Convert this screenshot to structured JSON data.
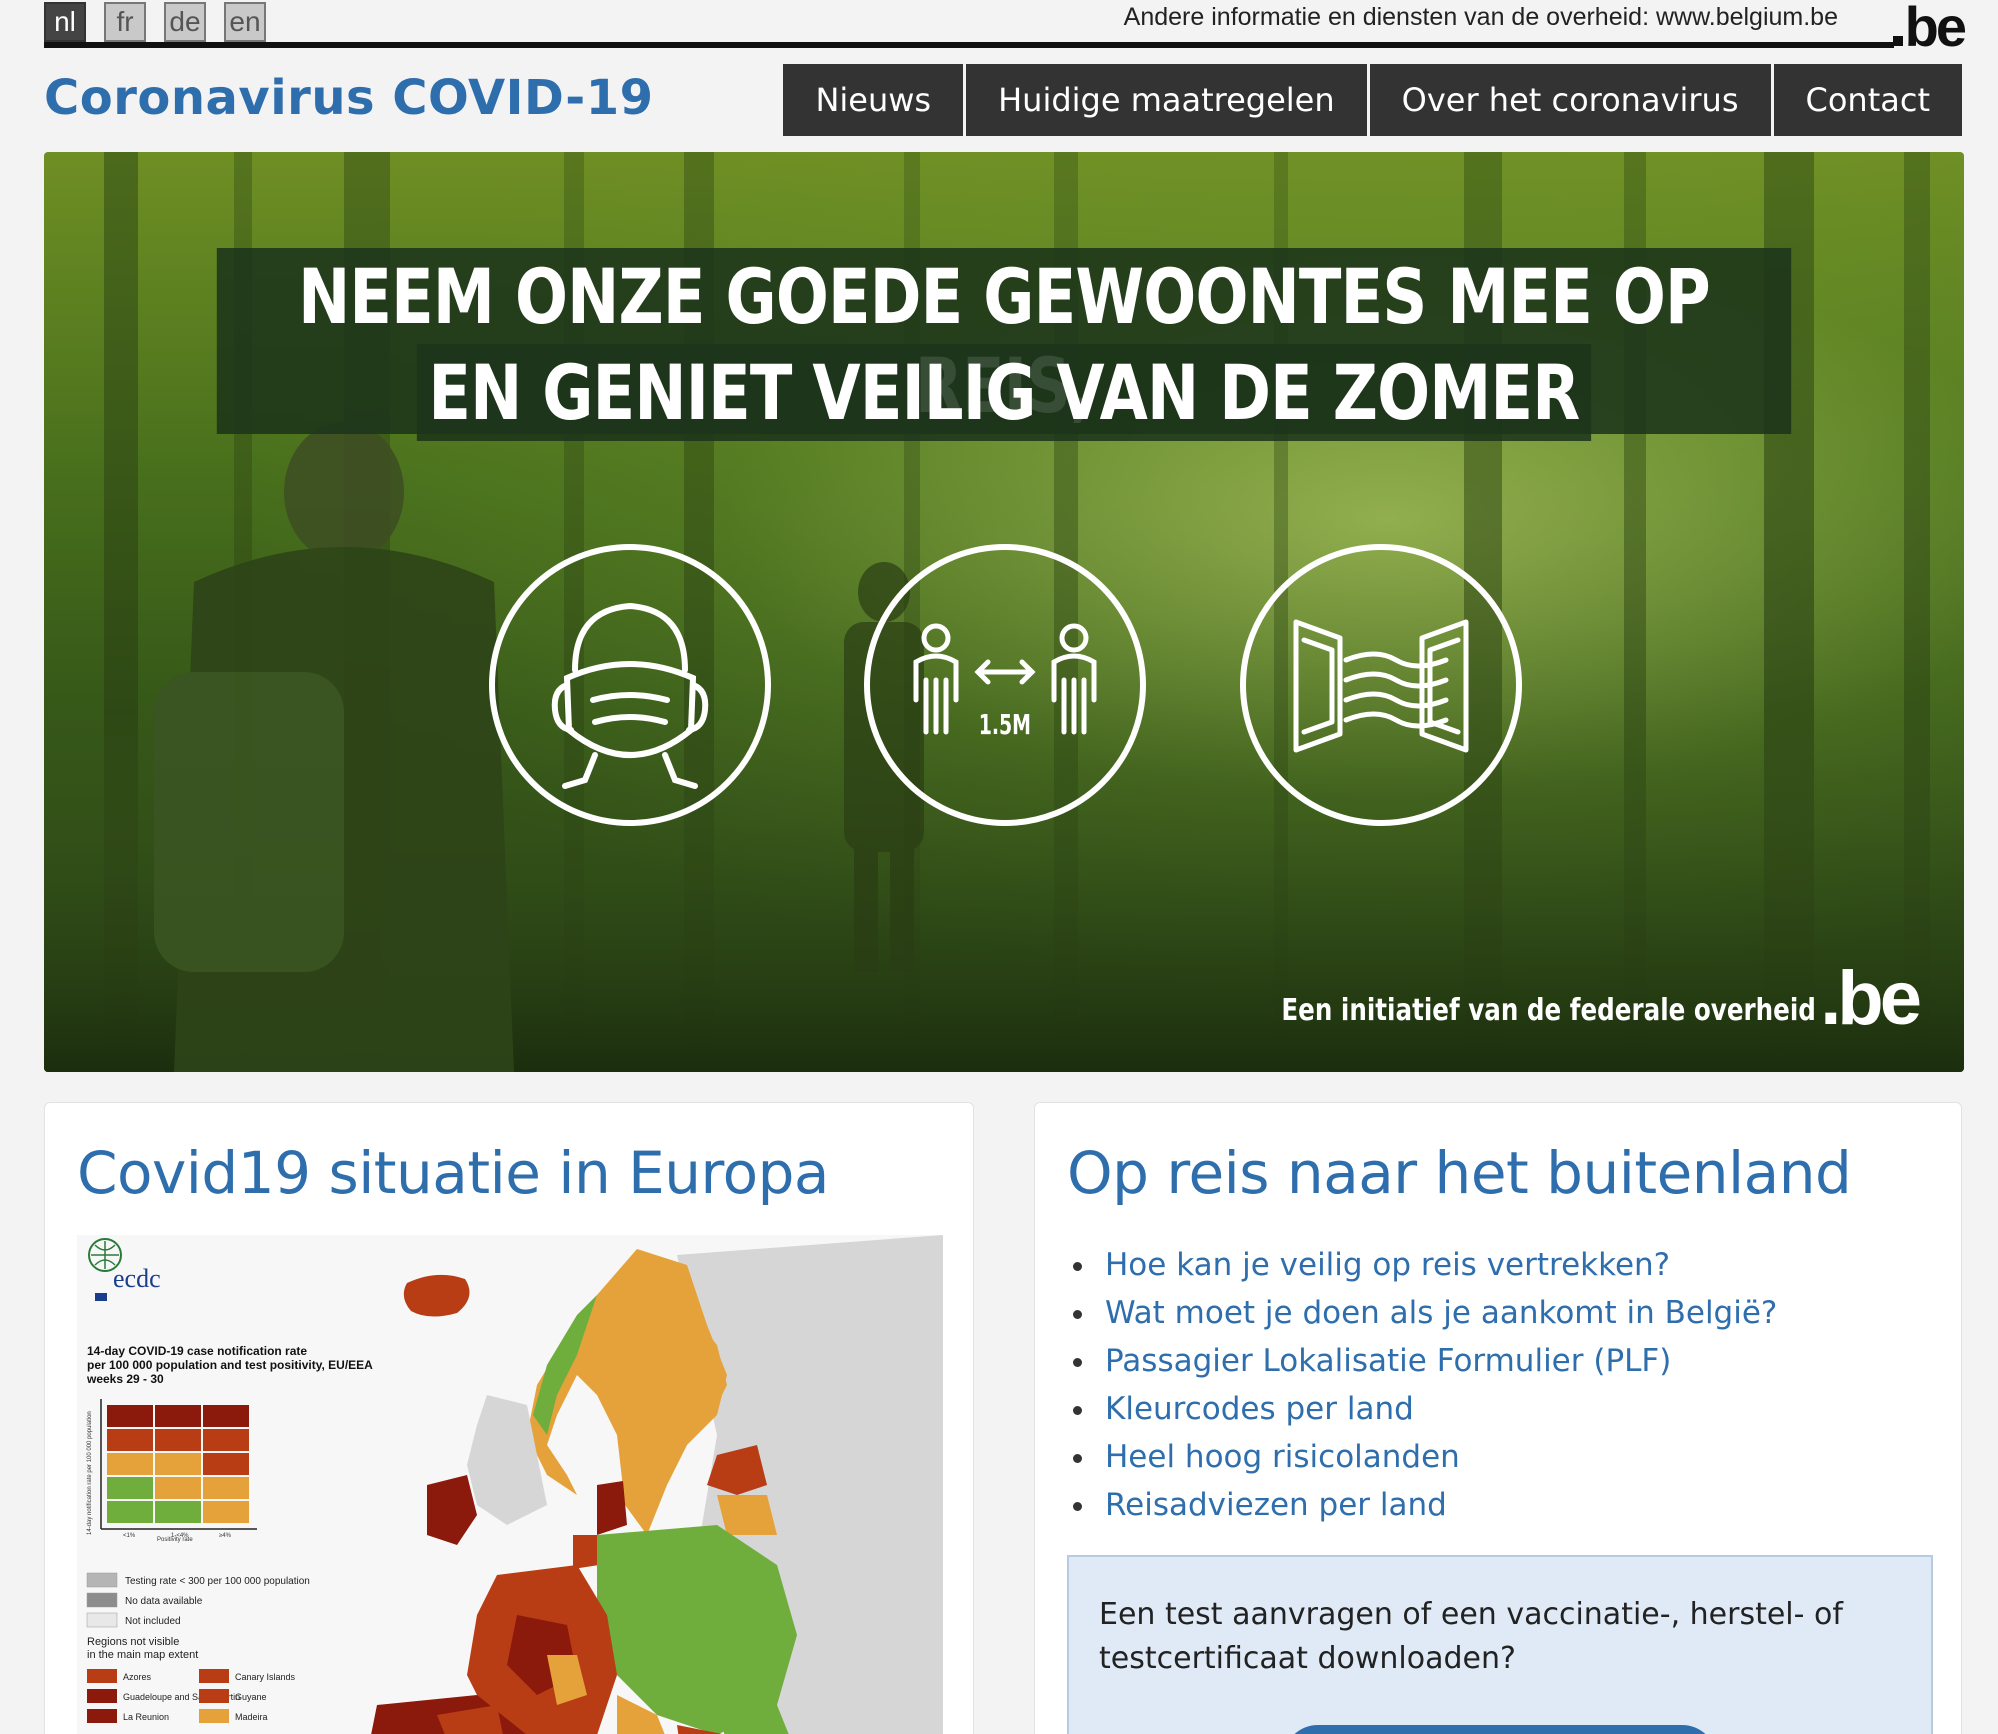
{
  "languages": [
    {
      "code": "nl",
      "active": true
    },
    {
      "code": "fr",
      "active": false
    },
    {
      "code": "de",
      "active": false
    },
    {
      "code": "en",
      "active": false
    }
  ],
  "top_bar": {
    "gov_link_text": "Andere informatie en diensten van de overheid: www.belgium.be",
    "logo_text": "be"
  },
  "header": {
    "title": "Coronavirus COVID-19",
    "nav": [
      "Nieuws",
      "Huidige maatregelen",
      "Over het coronavirus",
      "Contact"
    ]
  },
  "hero": {
    "headline_line1": "NEEM ONZE GOEDE GEWOONTES MEE OP REIS,",
    "headline_line2": "EN GENIET VEILIG VAN DE ZOMER",
    "distance_label": "1.5M",
    "initiative_text": "Een initiatief van de federale overheid",
    "initiative_logo": ".be",
    "icons": [
      "face-mask-icon",
      "distance-icon",
      "ventilation-window-icon"
    ]
  },
  "europe_card": {
    "title": "Covid19 situatie in Europa",
    "map": {
      "org_logo_text": "ecdc",
      "title_line1": "14-day COVID-19 case notification rate",
      "title_line2": "per 100 000 population and test positivity, EU/EEA",
      "title_line3": "weeks 29 - 30",
      "y_axis_label": "14-day notification rate per 100 000 population",
      "x_axis_label": "Positivity rate",
      "x_ticks": [
        "<1%",
        "1-<4%",
        "≥4%"
      ],
      "legend": [
        "Testing rate < 300 per 100 000 population",
        "No data available",
        "Not included"
      ],
      "regions_note_line1": "Regions not visible",
      "regions_note_line2": "in the main map extent",
      "regions": [
        "Azores",
        "Canary Islands",
        "Guadeloupe and Saint Martin",
        "Guyane",
        "La Reunion",
        "Madeira"
      ]
    }
  },
  "travel_card": {
    "title": "Op reis naar het buitenland",
    "links": [
      "Hoe kan je veilig op reis vertrekken?",
      "Wat moet je doen als je aankomt in België?",
      "Passagier Lokalisatie Formulier (PLF)",
      "Kleurcodes per land",
      "Heel hoog risicolanden",
      "Reisadviezen per land"
    ],
    "info_box_text": "Een test aanvragen of een vaccinatie-, herstel- of testcertificaat downloaden?"
  },
  "colors": {
    "brand_blue": "#2f6ead",
    "nav_dark": "#333333",
    "hero_green": "#486f1c",
    "map_dark_red": "#8b1a0c",
    "map_red": "#b83c14",
    "map_orange": "#e6a23a",
    "map_green": "#6fae3c",
    "map_grey": "#d9d9d9"
  }
}
